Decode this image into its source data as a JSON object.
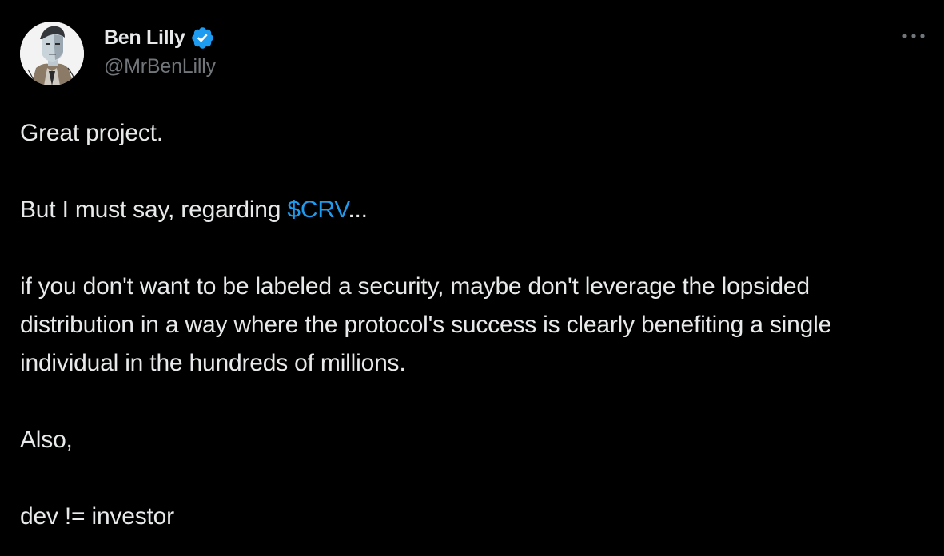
{
  "author": {
    "display_name": "Ben Lilly",
    "handle": "@MrBenLilly",
    "verified": true
  },
  "tweet": {
    "line1": "Great project.",
    "line2_prefix": "But I must say, regarding ",
    "cashtag": "$CRV",
    "line2_suffix": "...",
    "paragraph3": "if you don't want to be labeled a security, maybe don't leverage the lopsided distribution in a way where the protocol's success is clearly benefiting a single individual in the hundreds of millions.",
    "line4": "Also,",
    "line5": "dev != investor"
  },
  "icons": {
    "verified": "verified-badge-icon",
    "more": "more-horizontal-icon"
  },
  "colors": {
    "background": "#000000",
    "text": "#e7e9ea",
    "secondary_text": "#71767b",
    "accent": "#1d9bf0"
  }
}
